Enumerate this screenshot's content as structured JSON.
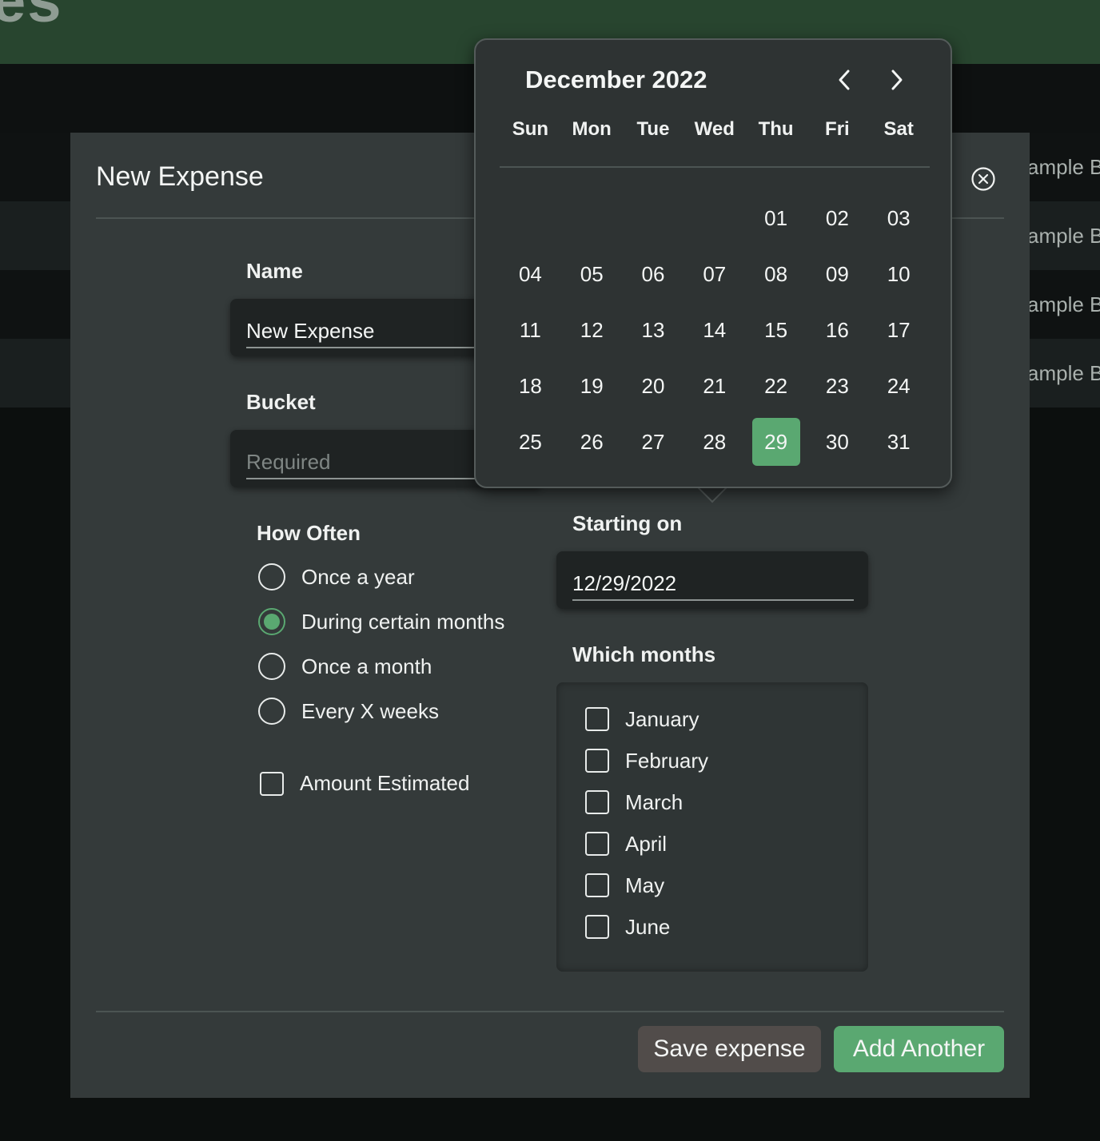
{
  "background": {
    "logo_fragment": "es",
    "rows": [
      "ample B",
      "ample B",
      "ample B",
      "ample B"
    ]
  },
  "modal": {
    "title": "New Expense",
    "close_icon": "circle-x-icon",
    "name": {
      "label": "Name",
      "value": "New Expense"
    },
    "bucket": {
      "label": "Bucket",
      "placeholder": "Required"
    },
    "how_often": {
      "label": "How Often",
      "options": [
        {
          "label": "Once a year",
          "checked": false
        },
        {
          "label": "During certain months",
          "checked": true
        },
        {
          "label": "Once a month",
          "checked": false
        },
        {
          "label": "Every X weeks",
          "checked": false
        }
      ]
    },
    "amount_estimated": {
      "label": "Amount Estimated",
      "checked": false
    },
    "starting_on": {
      "label": "Starting on",
      "value": "12/29/2022"
    },
    "which_months": {
      "label": "Which months",
      "months": [
        "January",
        "February",
        "March",
        "April",
        "May",
        "June"
      ]
    },
    "buttons": {
      "save": "Save expense",
      "add_another": "Add Another"
    }
  },
  "calendar": {
    "title": "December 2022",
    "prev_icon": "chevron-left-icon",
    "next_icon": "chevron-right-icon",
    "weekdays": [
      "Sun",
      "Mon",
      "Tue",
      "Wed",
      "Thu",
      "Fri",
      "Sat"
    ],
    "weeks": [
      [
        "",
        "",
        "",
        "",
        "01",
        "02",
        "03"
      ],
      [
        "04",
        "05",
        "06",
        "07",
        "08",
        "09",
        "10"
      ],
      [
        "11",
        "12",
        "13",
        "14",
        "15",
        "16",
        "17"
      ],
      [
        "18",
        "19",
        "20",
        "21",
        "22",
        "23",
        "24"
      ],
      [
        "25",
        "26",
        "27",
        "28",
        "29",
        "30",
        "31"
      ]
    ],
    "selected_day": "29"
  },
  "colors": {
    "accent": "#5aa871",
    "header_green": "#28452f",
    "modal_bg": "#343a3a"
  }
}
